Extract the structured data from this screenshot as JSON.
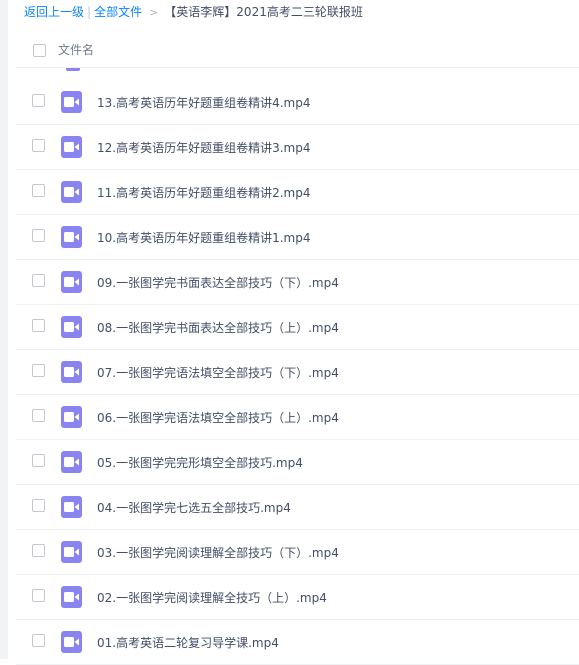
{
  "breadcrumb": {
    "back": "返回上一级",
    "separator": "|",
    "all_files": "全部文件",
    "arrow": ">",
    "current": "【英语李辉】2021高考二三轮联报班"
  },
  "header": {
    "column_name": "文件名"
  },
  "files": [
    {
      "name": "13.高考英语历年好题重组卷精讲4.mp4",
      "icon": "video-file-icon"
    },
    {
      "name": "12.高考英语历年好题重组卷精讲3.mp4",
      "icon": "video-file-icon"
    },
    {
      "name": "11.高考英语历年好题重组卷精讲2.mp4",
      "icon": "video-file-icon"
    },
    {
      "name": "10.高考英语历年好题重组卷精讲1.mp4",
      "icon": "video-file-icon"
    },
    {
      "name": "09.一张图学完书面表达全部技巧（下）.mp4",
      "icon": "video-file-icon"
    },
    {
      "name": "08.一张图学完书面表达全部技巧（上）.mp4",
      "icon": "video-file-icon"
    },
    {
      "name": "07.一张图学完语法填空全部技巧（下）.mp4",
      "icon": "video-file-icon"
    },
    {
      "name": "06.一张图学完语法填空全部技巧（上）.mp4",
      "icon": "video-file-icon"
    },
    {
      "name": "05.一张图学完完形填空全部技巧.mp4",
      "icon": "video-file-icon"
    },
    {
      "name": "04.一张图学完七选五全部技巧.mp4",
      "icon": "video-file-icon"
    },
    {
      "name": "03.一张图学完阅读理解全部技巧（下）.mp4",
      "icon": "video-file-icon"
    },
    {
      "name": "02.一张图学完阅读理解全技巧（上）.mp4",
      "icon": "video-file-icon"
    },
    {
      "name": "01.高考英语二轮复习导学课.mp4",
      "icon": "video-file-icon"
    }
  ],
  "colors": {
    "link": "#0a84ff",
    "icon": "#8a84f0",
    "text": "#424e67"
  }
}
